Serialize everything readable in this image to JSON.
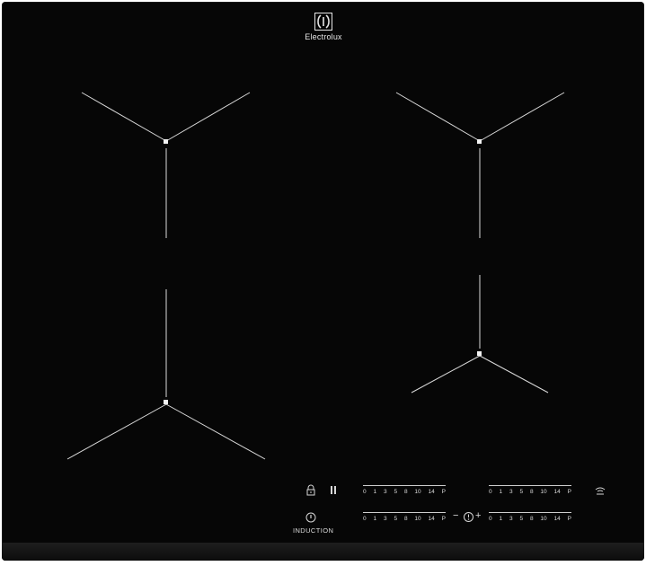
{
  "brand": {
    "name": "Electrolux",
    "logo": "electrolux-logo"
  },
  "zones": [
    {
      "id": "front-left-top",
      "type": "induction"
    },
    {
      "id": "front-left-bottom",
      "type": "induction"
    },
    {
      "id": "front-right-top",
      "type": "induction"
    },
    {
      "id": "front-right-bottom",
      "type": "induction"
    }
  ],
  "controls": {
    "lock_icon": "lock-icon",
    "pause_icon": "pause-icon",
    "power_icon": "power-icon",
    "wifi_icon": "wifi-hob-hood-icon",
    "induction_label": "INDUCTION",
    "timer": {
      "minus": "−",
      "plus": "+",
      "icon": "timer-icon"
    },
    "sliders": [
      {
        "name": "zone-slider-top-left",
        "ticks": [
          "0",
          "1",
          "3",
          "5",
          "8",
          "10",
          "14",
          "P"
        ]
      },
      {
        "name": "zone-slider-bottom-left",
        "ticks": [
          "0",
          "1",
          "3",
          "5",
          "8",
          "10",
          "14",
          "P"
        ]
      },
      {
        "name": "zone-slider-top-right",
        "ticks": [
          "0",
          "1",
          "3",
          "5",
          "8",
          "10",
          "14",
          "P"
        ]
      },
      {
        "name": "zone-slider-bottom-right",
        "ticks": [
          "0",
          "1",
          "3",
          "5",
          "8",
          "10",
          "14",
          "P"
        ]
      }
    ]
  }
}
